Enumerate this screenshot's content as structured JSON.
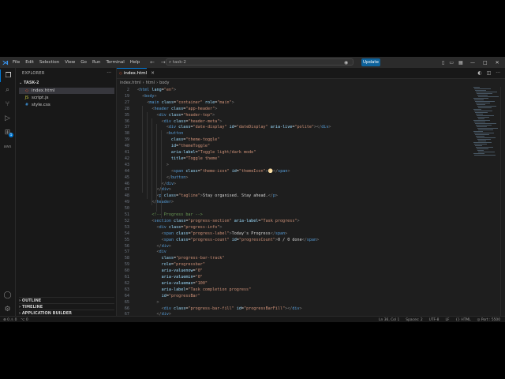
{
  "titlebar": {
    "menus": [
      "File",
      "Edit",
      "Selection",
      "View",
      "Go",
      "Run",
      "Terminal",
      "Help"
    ],
    "search": "task-2",
    "update_label": "Update"
  },
  "sidebar": {
    "title": "EXPLORER",
    "folder": "TASK-2",
    "files": [
      {
        "name": "index.html",
        "type": "html",
        "selected": true
      },
      {
        "name": "script.js",
        "type": "js",
        "selected": false
      },
      {
        "name": "style.css",
        "type": "css",
        "selected": false
      }
    ],
    "sections": [
      "OUTLINE",
      "TIMELINE",
      "APPLICATION BUILDER"
    ]
  },
  "editor": {
    "tab": "index.html",
    "breadcrumbs": [
      "index.html",
      "html",
      "body"
    ],
    "lines": [
      {
        "n": "2",
        "text": "<html lang=\"en\">"
      },
      {
        "n": "19",
        "text": "  <body>"
      },
      {
        "n": "27",
        "text": "    <main class=\"container\" role=\"main\">"
      },
      {
        "n": "28",
        "text": "      <header class=\"app-header\">"
      },
      {
        "n": "35",
        "text": "        <div class=\"header-top\">"
      },
      {
        "n": "36",
        "text": "          <div class=\"header-meta\">"
      },
      {
        "n": "37",
        "text": "            <div class=\"date-display\" id=\"dateDisplay\" aria-live=\"polite\"></div>"
      },
      {
        "n": "38",
        "text": "            <button"
      },
      {
        "n": "39",
        "text": "              class=\"theme-toggle\""
      },
      {
        "n": "40",
        "text": "              id=\"themeToggle\""
      },
      {
        "n": "41",
        "text": "              aria-label=\"Toggle light/dark mode\""
      },
      {
        "n": "42",
        "text": "              title=\"Toggle theme\""
      },
      {
        "n": "43",
        "text": "            >"
      },
      {
        "n": "44",
        "text": "              <span class=\"theme-icon\" id=\"themeIcon\">🌕</span>"
      },
      {
        "n": "45",
        "text": "            </button>"
      },
      {
        "n": "46",
        "text": "          </div>"
      },
      {
        "n": "47",
        "text": "        </div>"
      },
      {
        "n": "48",
        "text": "        <p class=\"tagline\">Stay organised. Stay ahead.</p>"
      },
      {
        "n": "49",
        "text": "      </header>"
      },
      {
        "n": "50",
        "text": ""
      },
      {
        "n": "51",
        "text": "      <!-- Progress bar -->"
      },
      {
        "n": "52",
        "text": "      <section class=\"progress-section\" aria-label=\"Task progress\">"
      },
      {
        "n": "53",
        "text": "        <div class=\"progress-info\">"
      },
      {
        "n": "54",
        "text": "          <span class=\"progress-label\">Today's Progress</span>"
      },
      {
        "n": "55",
        "text": "          <span class=\"progress-count\" id=\"progressCount\">0 / 0 done</span>"
      },
      {
        "n": "56",
        "text": "        </div>"
      },
      {
        "n": "57",
        "text": "        <div"
      },
      {
        "n": "58",
        "text": "          class=\"progress-bar-track\""
      },
      {
        "n": "59",
        "text": "          role=\"progressbar\""
      },
      {
        "n": "60",
        "text": "          aria-valuenow=\"0\""
      },
      {
        "n": "61",
        "text": "          aria-valuemin=\"0\""
      },
      {
        "n": "62",
        "text": "          aria-valuemax=\"100\""
      },
      {
        "n": "63",
        "text": "          aria-label=\"Task completion progress\""
      },
      {
        "n": "64",
        "text": "          id=\"progressBar\""
      },
      {
        "n": "65",
        "text": "        >"
      },
      {
        "n": "66",
        "text": "          <div class=\"progress-bar-fill\" id=\"progressBarFill\"></div>"
      },
      {
        "n": "67",
        "text": "        </div>"
      }
    ]
  },
  "statusbar": {
    "left": [
      "⊗ 0 ⚠ 0",
      "⌥ 0"
    ],
    "right": [
      "Ln 36, Col 1",
      "Spaces: 2",
      "UTF-8",
      "LF",
      "{} HTML",
      "◎ Port : 5500"
    ]
  },
  "colors": {
    "accent": "#0078d4",
    "update": "#0e639c",
    "editor_bg": "#1e1e1e"
  }
}
